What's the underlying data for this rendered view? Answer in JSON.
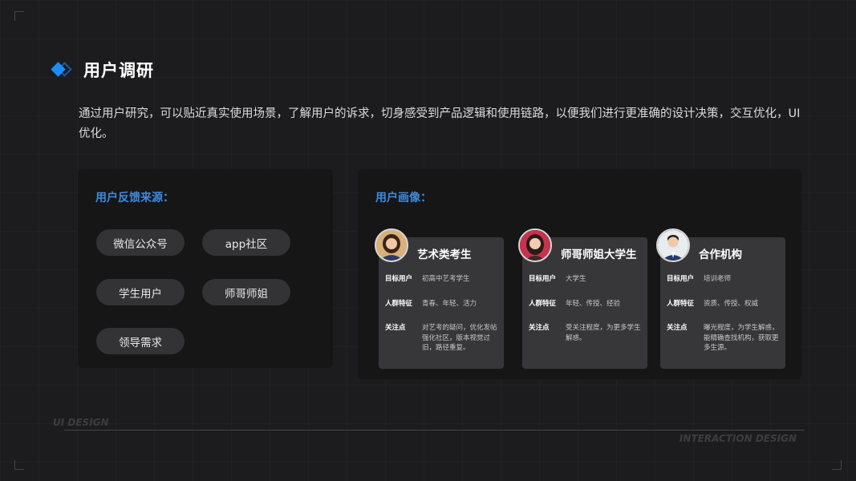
{
  "header": {
    "title": "用户调研"
  },
  "intro": "通过用户研究，可以贴近真实使用场景，了解用户的诉求，切身感受到产品逻辑和使用链路，以便我们进行更准确的设计决策，交互优化，UI优化。",
  "feedback": {
    "heading": "用户反馈来源：",
    "sources": [
      "微信公众号",
      "app社区",
      "学生用户",
      "师哥师姐",
      "领导需求"
    ]
  },
  "personas": {
    "heading": "用户画像：",
    "cards": [
      {
        "name": "艺术类考生",
        "avatar": "student-girl-avatar",
        "rows": [
          {
            "label": "目标用户",
            "value": "初高中艺考学生"
          },
          {
            "label": "人群特征",
            "value": "青春、年轻、活力"
          },
          {
            "label": "关注点",
            "value": "对艺考的疑问，优化发帖强化社区，版本视觉过旧，路径重复。"
          }
        ]
      },
      {
        "name": "师哥师姐大学生",
        "avatar": "college-student-avatar",
        "rows": [
          {
            "label": "目标用户",
            "value": "大学生"
          },
          {
            "label": "人群特征",
            "value": "年轻、传授、经验"
          },
          {
            "label": "关注点",
            "value": "受关注程度，为更多学生解惑。"
          }
        ]
      },
      {
        "name": "合作机构",
        "avatar": "business-man-avatar",
        "rows": [
          {
            "label": "目标用户",
            "value": "培训老师"
          },
          {
            "label": "人群特征",
            "value": "资质、传授、权威"
          },
          {
            "label": "关注点",
            "value": "曝光程度，为学生解惑，能精确查找机构，获取更多生源。"
          }
        ]
      }
    ]
  },
  "footer": {
    "left": "UI DESIGN",
    "right": "INTERACTION DESIGN"
  },
  "colors": {
    "accent": "#1e8cff",
    "heading": "#3e8bdc",
    "background": "#1c1c1e"
  }
}
